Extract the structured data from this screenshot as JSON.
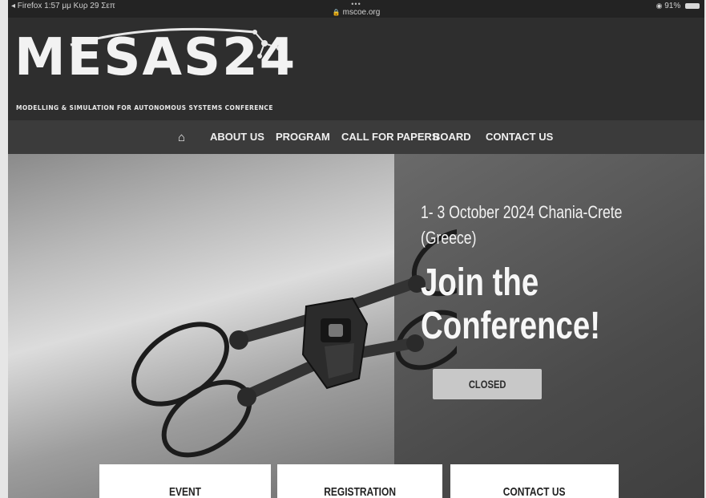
{
  "status_bar": {
    "left_text": "◂ Firefox   1:57 μμ   Κυρ 29 Σεπ",
    "dots": "•••",
    "url": "mscoe.org",
    "battery": "91%"
  },
  "logo": {
    "name": "MESAS24",
    "tagline": "MODELLING & SIMULATION FOR AUTONOMOUS SYSTEMS CONFERENCE"
  },
  "nav": {
    "home_icon": "home-icon",
    "items": [
      "ABOUT US",
      "PROGRAM",
      "CALL FOR PAPERS",
      "BOARD",
      "CONTACT US"
    ]
  },
  "hero": {
    "date": "1- 3 October 2024 Chania-Crete (Greece)",
    "title": "Join the Conference!",
    "button_label": "CLOSED"
  },
  "cards": [
    {
      "title": "EVENT"
    },
    {
      "title": "REGISTRATION"
    },
    {
      "title": "CONTACT US"
    }
  ]
}
